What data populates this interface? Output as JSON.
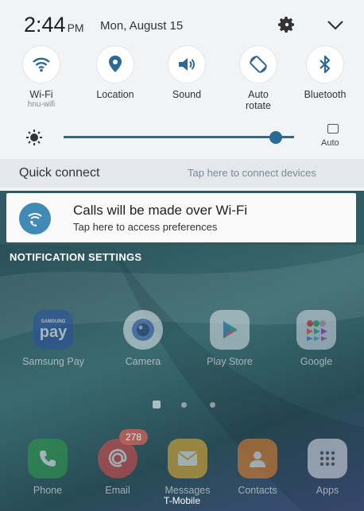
{
  "status": {
    "time": "2:44",
    "ampm": "PM",
    "date": "Mon, August 15",
    "settings_icon": "gear-icon",
    "expand_icon": "chevron-down-icon"
  },
  "toggles": [
    {
      "label": "Wi-Fi",
      "sub": "hnu-wifi",
      "icon": "wifi-icon"
    },
    {
      "label": "Location",
      "sub": "",
      "icon": "location-icon"
    },
    {
      "label": "Sound",
      "sub": "",
      "icon": "sound-icon"
    },
    {
      "label": "Auto",
      "label2": "rotate",
      "icon": "rotate-icon"
    },
    {
      "label": "Bluetooth",
      "sub": "",
      "icon": "bluetooth-icon"
    }
  ],
  "brightness": {
    "level": 0.92,
    "auto_label": "Auto",
    "accent": "#2b6a96"
  },
  "quick_connect": {
    "title": "Quick connect",
    "hint": "Tap here to connect devices"
  },
  "notification": {
    "title": "Calls will be made over Wi-Fi",
    "subtitle": "Tap here to access preferences",
    "icon": "wifi-calling-icon"
  },
  "notification_settings": "NOTIFICATION SETTINGS",
  "home": {
    "apps_row1": [
      {
        "label": "Samsung Pay",
        "icon": "samsung-pay-icon",
        "icon_text": "pay",
        "brand_text": "SAMSUNG"
      },
      {
        "label": "Camera",
        "icon": "camera-icon"
      },
      {
        "label": "Play Store",
        "icon": "play-store-icon"
      },
      {
        "label": "Google",
        "icon": "google-folder-icon"
      }
    ],
    "dock": [
      {
        "label": "Phone",
        "icon": "phone-icon"
      },
      {
        "label": "Email",
        "icon": "email-icon",
        "badge": "278"
      },
      {
        "label": "Messages",
        "icon": "messages-icon"
      },
      {
        "label": "Contacts",
        "icon": "contacts-icon"
      },
      {
        "label": "Apps",
        "icon": "apps-grid-icon"
      }
    ],
    "carrier": "T-Mobile"
  }
}
